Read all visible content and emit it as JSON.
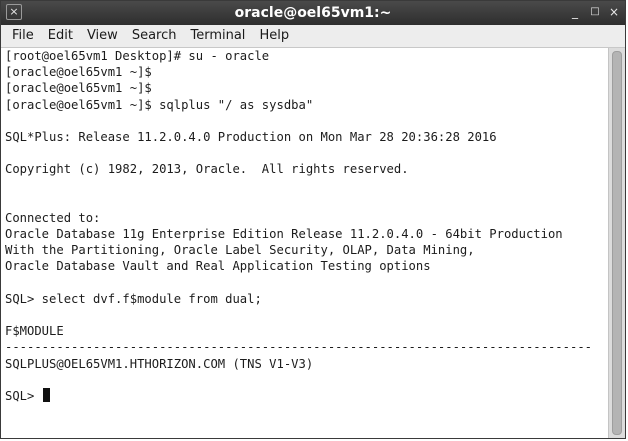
{
  "window": {
    "title": "oracle@oel65vm1:~",
    "close_glyph": "×",
    "minimize_glyph": "_",
    "maximize_glyph": "□",
    "close_right_glyph": "×"
  },
  "menu": [
    "File",
    "Edit",
    "View",
    "Search",
    "Terminal",
    "Help"
  ],
  "terminal": {
    "lines": [
      "[root@oel65vm1 Desktop]# su - oracle",
      "[oracle@oel65vm1 ~]$",
      "[oracle@oel65vm1 ~]$",
      "[oracle@oel65vm1 ~]$ sqlplus \"/ as sysdba\"",
      "",
      "SQL*Plus: Release 11.2.0.4.0 Production on Mon Mar 28 20:36:28 2016",
      "",
      "Copyright (c) 1982, 2013, Oracle.  All rights reserved.",
      "",
      "",
      "Connected to:",
      "Oracle Database 11g Enterprise Edition Release 11.2.0.4.0 - 64bit Production",
      "With the Partitioning, Oracle Label Security, OLAP, Data Mining,",
      "Oracle Database Vault and Real Application Testing options",
      "",
      "SQL> select dvf.f$module from dual;",
      "",
      "F$MODULE",
      "--------------------------------------------------------------------------------",
      "SQLPLUS@OEL65VM1.HTHORIZON.COM (TNS V1-V3)",
      "",
      "SQL> "
    ]
  }
}
